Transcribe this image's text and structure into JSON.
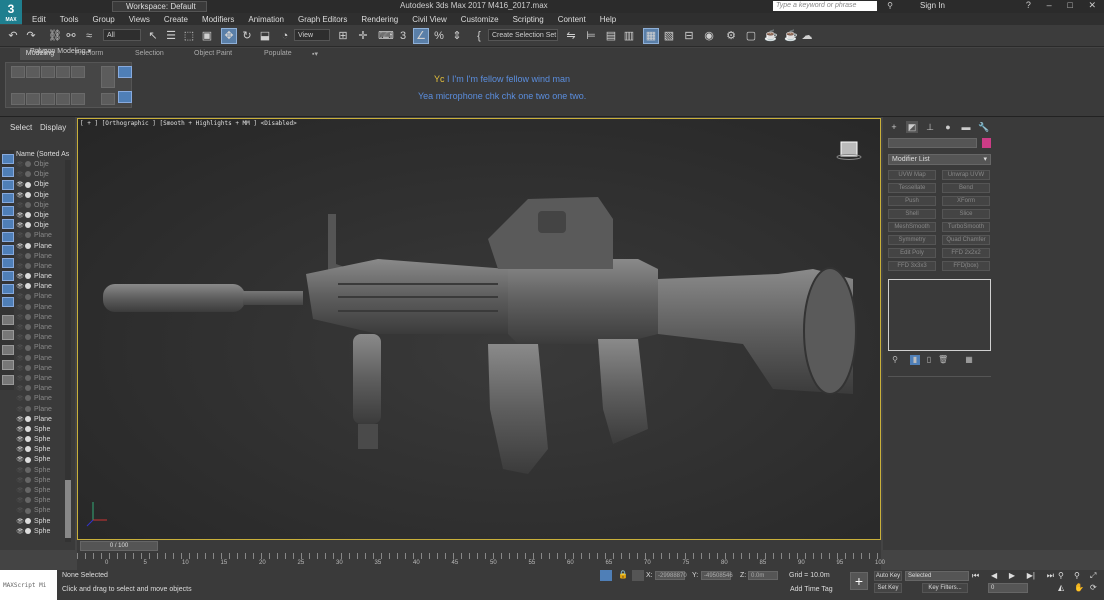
{
  "app": {
    "logo_label": "MAX",
    "workspace": "Workspace: Default",
    "title": "Autodesk 3ds Max 2017      M416_2017.max",
    "search_placeholder": "Type a keyword or phrase",
    "sign_in": "Sign In"
  },
  "menu": [
    "Edit",
    "Tools",
    "Group",
    "Views",
    "Create",
    "Modifiers",
    "Animation",
    "Graph Editors",
    "Rendering",
    "Civil View",
    "Customize",
    "Scripting",
    "Content",
    "Help"
  ],
  "toolbar": {
    "filter_value": "All",
    "refcoord_value": "View",
    "selection_set_placeholder": "Create Selection Set"
  },
  "ribbon": {
    "tabs": [
      "Modeling",
      "Freeform",
      "Selection",
      "Object Paint",
      "Populate"
    ],
    "panel_label": "Polygon Modeling"
  },
  "subtitles": {
    "line1_prefix": "Yc",
    "line1_rest": "I I'm I'm fellow fellow wind man",
    "line2": "Yea microphone chk chk one two one two."
  },
  "scene_explorer": {
    "select_tab": "Select",
    "display_tab": "Display",
    "header": "Name (Sorted As",
    "rows": [
      {
        "label": "Obje",
        "dim": true
      },
      {
        "label": "Obje",
        "dim": true
      },
      {
        "label": "Obje",
        "dim": false
      },
      {
        "label": "Obje",
        "dim": false
      },
      {
        "label": "Obje",
        "dim": true
      },
      {
        "label": "Obje",
        "dim": false
      },
      {
        "label": "Obje",
        "dim": false
      },
      {
        "label": "Plane",
        "dim": true
      },
      {
        "label": "Plane",
        "dim": false
      },
      {
        "label": "Plane",
        "dim": true
      },
      {
        "label": "Plane",
        "dim": true
      },
      {
        "label": "Plane",
        "dim": false
      },
      {
        "label": "Plane",
        "dim": false
      },
      {
        "label": "Plane",
        "dim": true
      },
      {
        "label": "Plane",
        "dim": true
      },
      {
        "label": "Plane",
        "dim": true
      },
      {
        "label": "Plane",
        "dim": true
      },
      {
        "label": "Plane",
        "dim": true
      },
      {
        "label": "Plane",
        "dim": true
      },
      {
        "label": "Plane",
        "dim": true
      },
      {
        "label": "Plane",
        "dim": true
      },
      {
        "label": "Plane",
        "dim": true
      },
      {
        "label": "Plane",
        "dim": true
      },
      {
        "label": "Plane",
        "dim": true
      },
      {
        "label": "Plane",
        "dim": true
      },
      {
        "label": "Plane",
        "dim": false
      },
      {
        "label": "Sphe",
        "dim": false
      },
      {
        "label": "Sphe",
        "dim": false
      },
      {
        "label": "Sphe",
        "dim": false
      },
      {
        "label": "Sphe",
        "dim": false
      },
      {
        "label": "Sphe",
        "dim": true
      },
      {
        "label": "Sphe",
        "dim": true
      },
      {
        "label": "Sphe",
        "dim": true
      },
      {
        "label": "Sphe",
        "dim": true
      },
      {
        "label": "Sphe",
        "dim": true
      },
      {
        "label": "Sphe",
        "dim": false
      },
      {
        "label": "Sphe",
        "dim": false
      }
    ]
  },
  "viewport": {
    "label": "[ + ] [Orthographic ] [Smooth + Highlights + MM ] <Disabled>"
  },
  "command_panel": {
    "modifier_list": "Modifier List",
    "modifier_buttons": [
      "UVW Map",
      "Unwrap UVW",
      "Tessellate",
      "Bend",
      "Push",
      "XForm",
      "Shell",
      "Slice",
      "MeshSmooth",
      "TurboSmooth",
      "Symmetry",
      "Quad Chamfer",
      "Edit Poly",
      "FFD 2x2x2",
      "FFD 3x3x3",
      "FFD(box)"
    ],
    "accent_color": "#cc3c86"
  },
  "timeline": {
    "slider_label": "0 / 100",
    "ticks": [
      "0",
      "5",
      "10",
      "15",
      "20",
      "25",
      "30",
      "35",
      "40",
      "45",
      "50",
      "55",
      "60",
      "65",
      "70",
      "75",
      "80",
      "85",
      "90",
      "95",
      "100"
    ]
  },
  "status": {
    "maxscript": "MAXScript Mi",
    "selection": "None Selected",
    "prompt": "Click and drag to select and move objects",
    "x_label": "X:",
    "x_value": "-29988870",
    "y_label": "Y:",
    "y_value": "-49508546",
    "z_label": "Z:",
    "z_value": "0.0m",
    "grid": "Grid = 10.0m",
    "add_time_tag": "Add Time Tag",
    "auto_key": "Auto Key",
    "set_key": "Set Key",
    "selected": "Selected",
    "key_filters": "Key Filters...",
    "frame": "0"
  }
}
